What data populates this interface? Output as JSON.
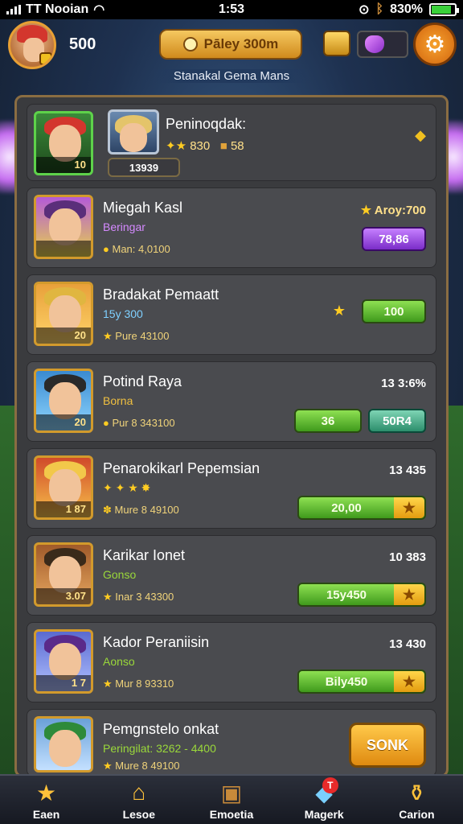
{
  "status_bar": {
    "carrier": "TT Nooian",
    "time": "1:53",
    "battery": "830%"
  },
  "header": {
    "coins": "500",
    "play_button": "Pāley 300m",
    "subtitle": "Stanakal Gema Mans"
  },
  "featured": {
    "title": "Peninoqdak:",
    "badge_num": "10",
    "stats": "830",
    "stats2": "58",
    "code": "13939"
  },
  "players": [
    {
      "name": "Miegah Kasl",
      "sub": "Beringar",
      "meta": "Man: 4,0100",
      "num": "",
      "right_top": "Aroy:700",
      "pill": "78,86",
      "pill_kind": "purple"
    },
    {
      "name": "Bradakat Pemaatt",
      "sub": "15y 300",
      "meta": "Pure 43100",
      "num": "20",
      "right_top": "",
      "pill": "100",
      "pill_kind": "green"
    },
    {
      "name": "Potind Raya",
      "sub": "Borna",
      "meta": "Pur 8 343100",
      "num": "20",
      "right_top": "13  3:6%",
      "pill": "36",
      "pill2": "50R4",
      "pill_kind": "split"
    },
    {
      "name": "Penarokikarl Pepemsian",
      "sub": "",
      "meta": "Mure 8 49100",
      "num": "1 87",
      "right_top": "13  435",
      "pill": "20,00",
      "pill_kind": "star"
    },
    {
      "name": "Karikar Ionet",
      "sub": "Gonso",
      "meta": "Inar 3 43300",
      "num": "3.07",
      "right_top": "10  383",
      "pill": "15y450",
      "pill_kind": "star"
    },
    {
      "name": "Kador Peraniisin",
      "sub": "Aonso",
      "meta": "Mur 8 93310",
      "num": "1 7",
      "right_top": "13  430",
      "pill": "Bily450",
      "pill_kind": "star"
    },
    {
      "name": "Pemgnstelo onkat",
      "sub": "Peringilat: 3262 - 4400",
      "meta": "Mure 8 49100",
      "num": "",
      "right_top": "",
      "pill": "SONK",
      "pill_kind": "orange"
    }
  ],
  "nav": [
    {
      "label": "Eaen",
      "icon": "star-icon"
    },
    {
      "label": "Lesoe",
      "icon": "house-icon"
    },
    {
      "label": "Emoetia",
      "icon": "chest-icon"
    },
    {
      "label": "Magerk",
      "icon": "gem-box-icon",
      "notif": "T"
    },
    {
      "label": "Carion",
      "icon": "treasure-icon"
    }
  ]
}
